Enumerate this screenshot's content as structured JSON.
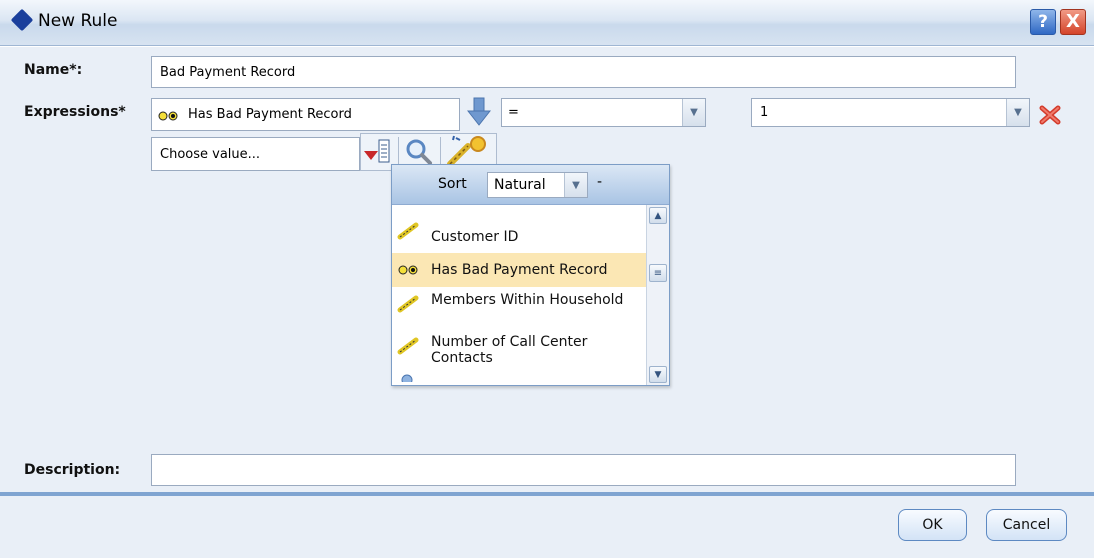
{
  "window": {
    "title": "New Rule",
    "help_label": "?",
    "close_label": "X"
  },
  "form": {
    "name_label": "Name*:",
    "name_value": "Bad Payment Record",
    "expressions_label": "Expressions*",
    "field_value": "Has Bad Payment Record",
    "operator_value": "=",
    "value_value": "1",
    "choose_value_placeholder": "Choose value...",
    "description_label": "Description:",
    "description_value": ""
  },
  "popup": {
    "sort_label": "Sort",
    "sort_value": "Natural",
    "sort_extra": "-",
    "items": [
      {
        "label": "Customer ID",
        "icon": "ruler-icon"
      },
      {
        "label": "Has Bad Payment Record",
        "icon": "flag-binary-icon",
        "selected": true
      },
      {
        "label": "Members Within Household",
        "icon": "ruler-icon"
      },
      {
        "label": "Number of Call Center Contacts",
        "icon": "ruler-icon"
      }
    ]
  },
  "buttons": {
    "ok": "OK",
    "cancel": "Cancel"
  },
  "colors": {
    "accent": "#7fa4d1",
    "selected_row": "#fbe7b4",
    "delete_icon": "#d33a2a"
  }
}
